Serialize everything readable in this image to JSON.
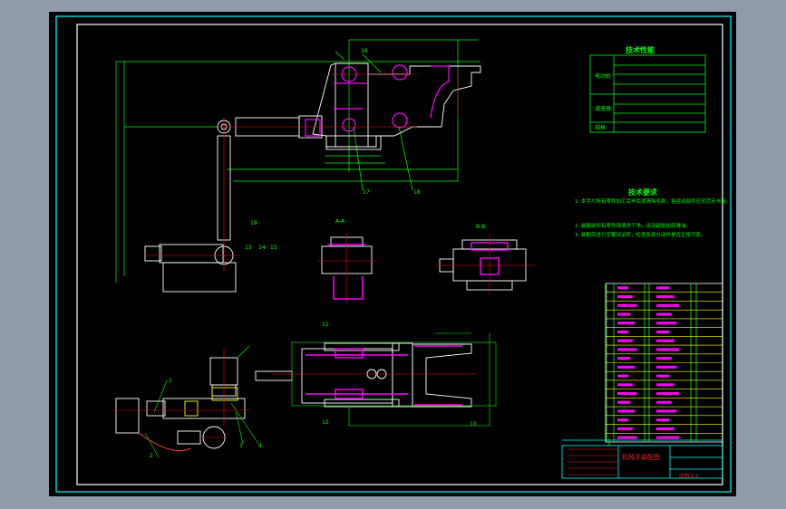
{
  "colors": {
    "background": "#8f9bab",
    "paper": "#000000",
    "frame": "#00ffff",
    "inner_frame": "#ffffff",
    "dimension": "#00ff00",
    "outline": "#ffffff",
    "hidden": "#ff00ff",
    "center": "#ff0000",
    "table_rows": "#ffff00"
  },
  "spec_table": {
    "title": "技术性能",
    "groups": [
      "电动机",
      "减速器",
      "规格"
    ]
  },
  "tech_requirements": {
    "title": "技术要求",
    "items": [
      "1. 本手爪所有零件加工完毕后须清除毛刺，各运动部件应灵活无卡阻。",
      "2. 装配前所有零件须清洗干净，运动副处加润滑油。",
      "3. 装配后进行空载试运转，检查各部分动作是否正常可靠。"
    ]
  },
  "part_labels": {
    "top": [
      "16",
      "17",
      "18",
      "19",
      "13",
      "14",
      "15"
    ],
    "section_a": "A-A",
    "section_b": "B-B",
    "bottom": [
      "1",
      "2",
      "3",
      "4",
      "10",
      "11",
      "12"
    ]
  },
  "title_block": {
    "drawing_title": "机械手装配图",
    "scale_label": "比例 1:2"
  }
}
